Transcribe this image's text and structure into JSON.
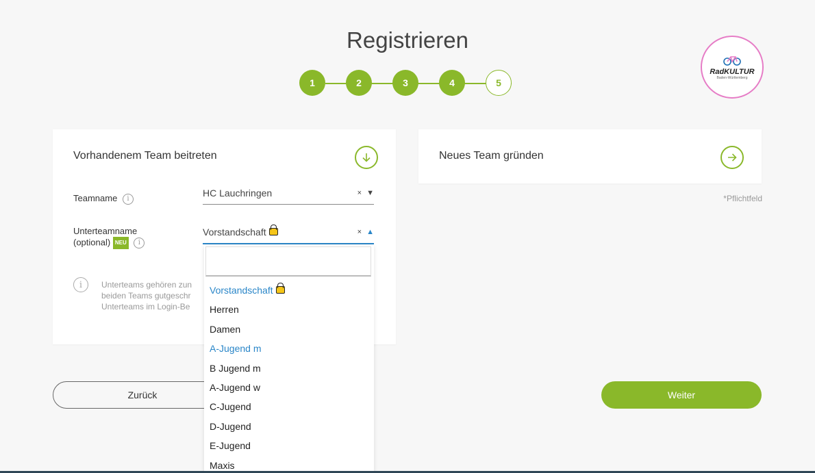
{
  "page": {
    "title": "Registrieren",
    "required_note": "*Pflichtfeld"
  },
  "stepper": {
    "steps": [
      "1",
      "2",
      "3",
      "4",
      "5"
    ],
    "current": 5
  },
  "logo": {
    "brand": "RadKULTUR",
    "sub": "Baden-Württemberg"
  },
  "join_card": {
    "title": "Vorhandenem Team beitreten",
    "teamname_label": "Teamname",
    "teamname_value": "HC Lauchringen",
    "subteam_label_line1": "Unterteamname",
    "subteam_label_line2": "(optional)",
    "neu_badge": "NEU",
    "subteam_value": "Vorstandschaft",
    "clear_symbol": "×",
    "note_line1": "Unterteams gehören zun",
    "note_line2": "beiden Teams gutgeschr",
    "note_line3": "Unterteams im Login-Be"
  },
  "new_card": {
    "title": "Neues Team gründen"
  },
  "dropdown": {
    "options": [
      {
        "label": "Vorstandschaft",
        "locked": true,
        "selected": true
      },
      {
        "label": "Herren",
        "locked": false,
        "selected": false
      },
      {
        "label": "Damen",
        "locked": false,
        "selected": false
      },
      {
        "label": "A-Jugend m",
        "locked": false,
        "selected": true
      },
      {
        "label": "B Jugend m",
        "locked": false,
        "selected": false
      },
      {
        "label": "A-Jugend w",
        "locked": false,
        "selected": false
      },
      {
        "label": "C-Jugend",
        "locked": false,
        "selected": false
      },
      {
        "label": "D-Jugend",
        "locked": false,
        "selected": false
      },
      {
        "label": "E-Jugend",
        "locked": false,
        "selected": false
      },
      {
        "label": "Maxis",
        "locked": false,
        "selected": false
      }
    ]
  },
  "buttons": {
    "back": "Zurück",
    "next": "Weiter"
  },
  "colors": {
    "accent": "#8ab82a",
    "link_blue": "#2a86c8",
    "footer": "#2f4656"
  }
}
